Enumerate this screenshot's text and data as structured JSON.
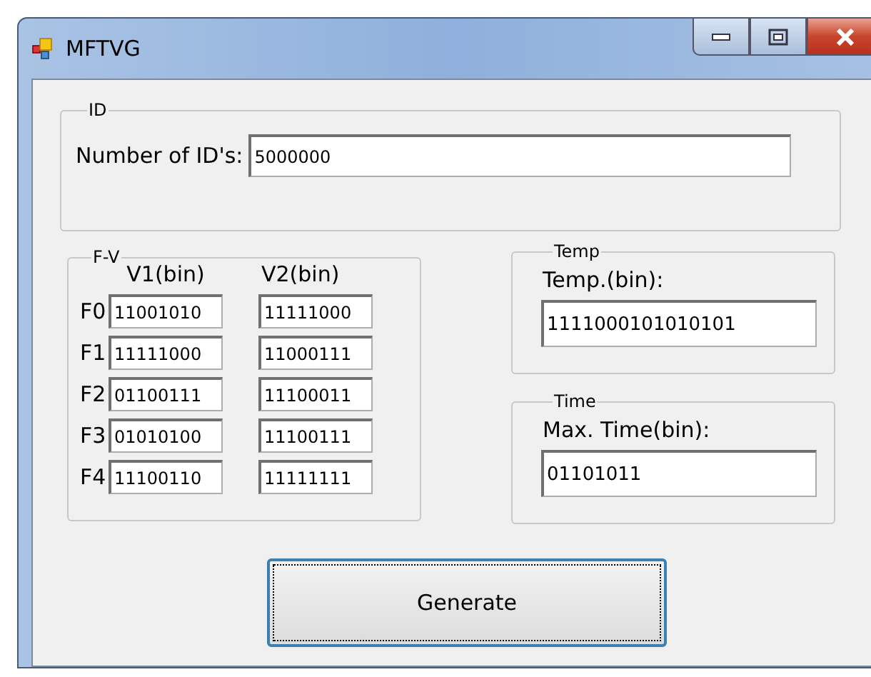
{
  "window": {
    "title": "MFTVG"
  },
  "id_group": {
    "title": "ID",
    "label": "Number of ID's:",
    "value": "5000000"
  },
  "fv_group": {
    "title": "F-V",
    "columns": [
      "V1(bin)",
      "V2(bin)"
    ],
    "rows": [
      {
        "label": "F0",
        "v1": "11001010",
        "v2": "11111000"
      },
      {
        "label": "F1",
        "v1": "11111000",
        "v2": "11000111"
      },
      {
        "label": "F2",
        "v1": "01100111",
        "v2": "11100011"
      },
      {
        "label": "F3",
        "v1": "01010100",
        "v2": "11100111"
      },
      {
        "label": "F4",
        "v1": "11100110",
        "v2": "11111111"
      }
    ]
  },
  "temp_group": {
    "title": "Temp",
    "label": "Temp.(bin):",
    "value": "1111000101010101"
  },
  "time_group": {
    "title": "Time",
    "label": "Max. Time(bin):",
    "value": "01101011"
  },
  "buttons": [
    {
      "label": "Generate",
      "focused": true
    }
  ]
}
